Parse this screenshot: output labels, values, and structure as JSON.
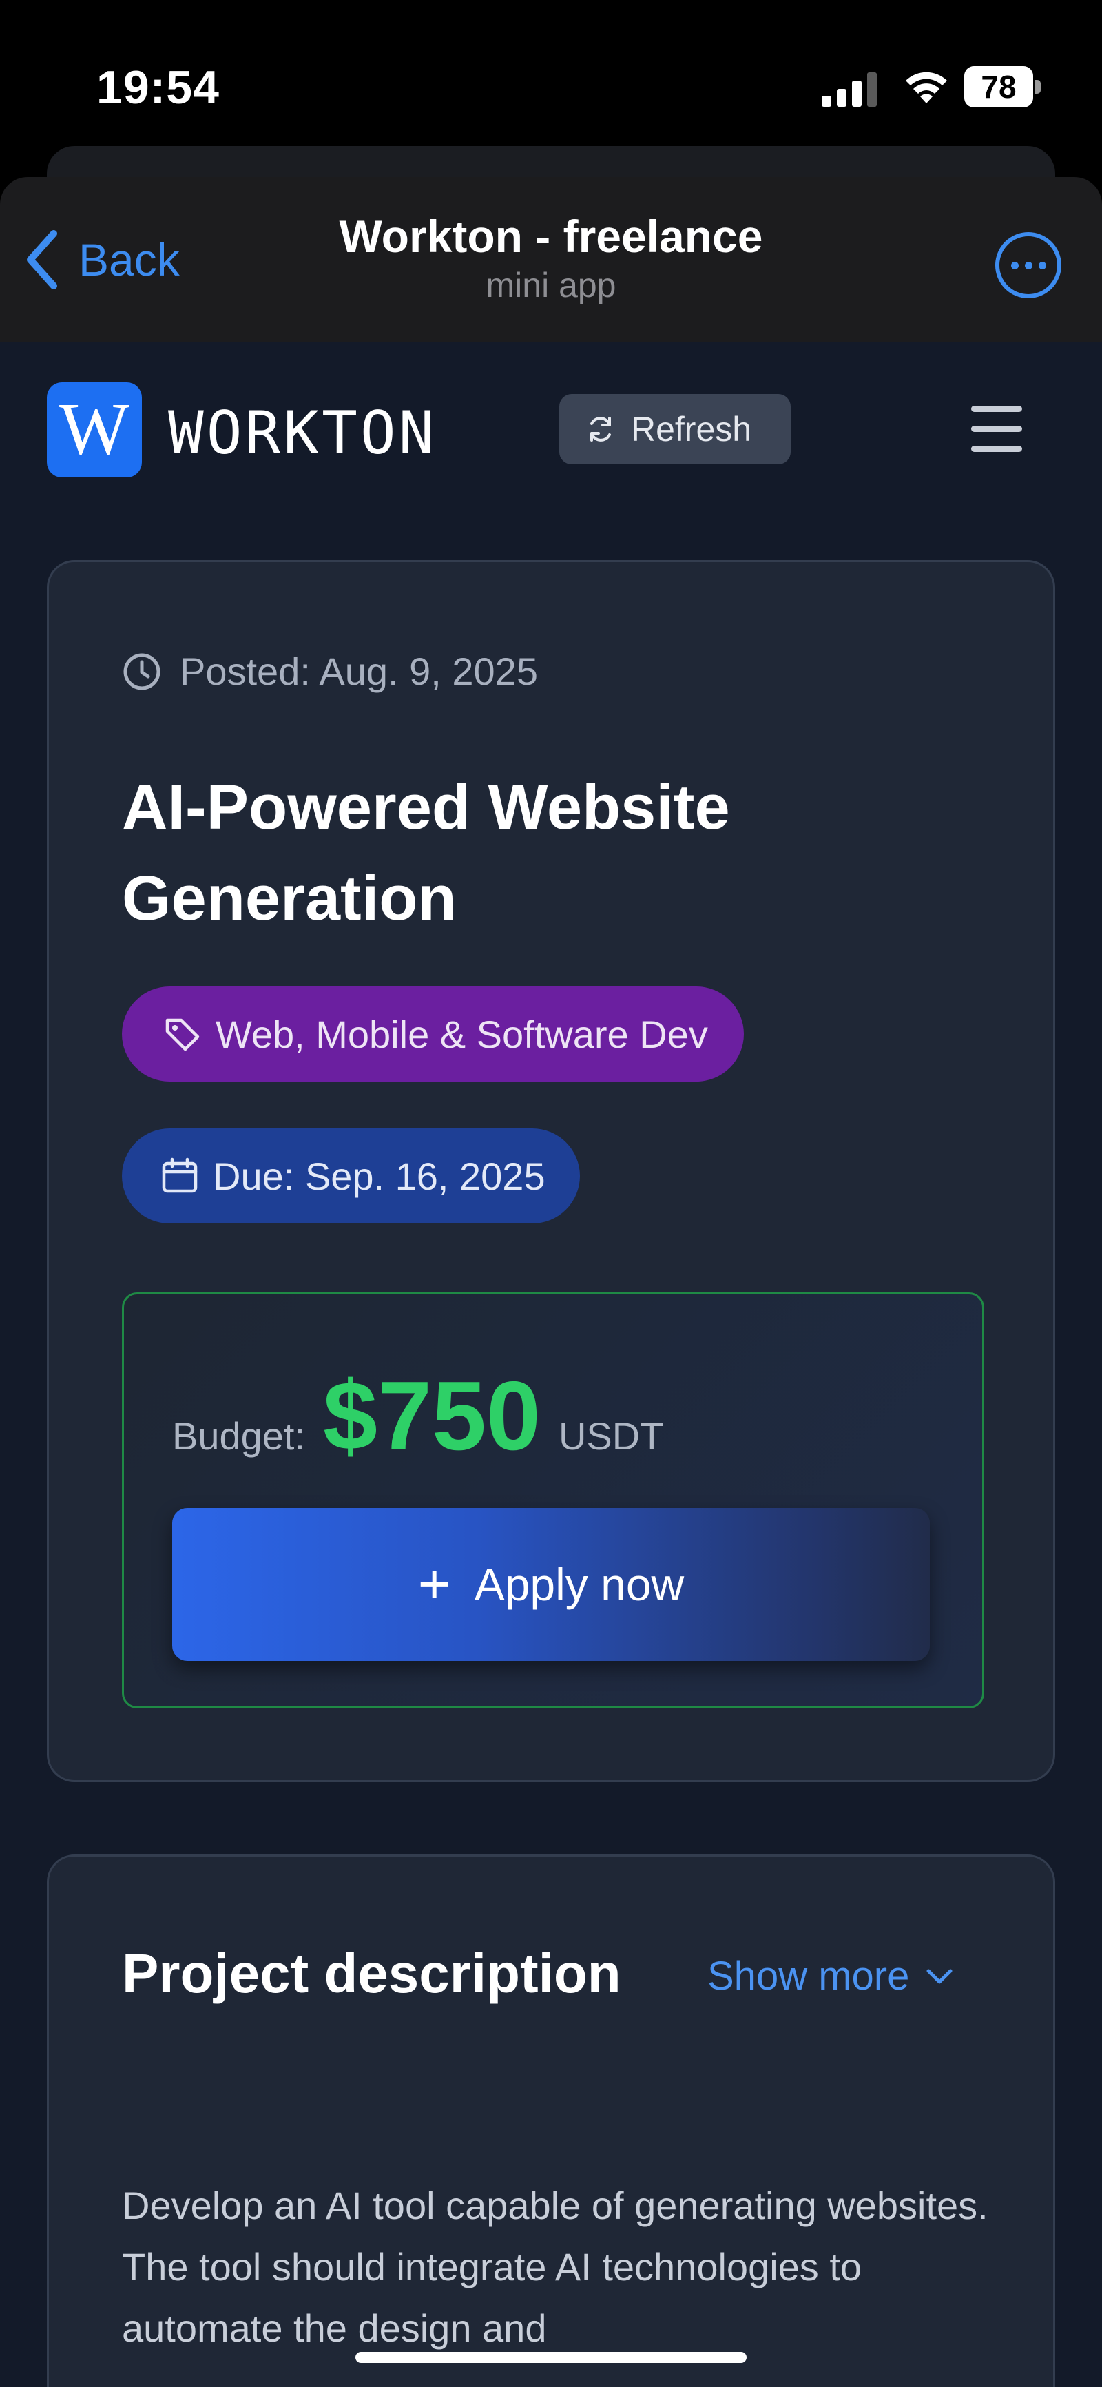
{
  "status_bar": {
    "time": "19:54",
    "battery_level": "78",
    "icons": [
      "signal-icon",
      "wifi-icon",
      "battery-icon"
    ]
  },
  "header": {
    "back_label": "Back",
    "title": "Workton - freelance",
    "subtitle": "mini app",
    "icons": [
      "chevron-left-icon",
      "more-icon"
    ]
  },
  "topbar": {
    "logo_letter": "W",
    "brand": "WORKTON",
    "refresh_label": "Refresh",
    "icons": [
      "refresh-icon",
      "menu-icon"
    ]
  },
  "job": {
    "posted": "Posted: Aug. 9, 2025",
    "title": "AI-Powered Website Generation",
    "category": "Web, Mobile & Software Dev",
    "due": "Due: Sep. 16, 2025",
    "budget_label": "Budget:",
    "budget_amount": "$750",
    "budget_currency": "USDT",
    "apply_plus": "+",
    "apply_label": "Apply now",
    "icons": [
      "clock-icon",
      "tag-icon",
      "calendar-icon",
      "plus-icon"
    ]
  },
  "description": {
    "heading": "Project description",
    "show_more": "Show more",
    "text": "Develop an AI tool capable of generating websites. The tool should integrate AI technologies to automate the design and",
    "icons": [
      "chevron-down-icon"
    ]
  },
  "colors": {
    "accent": "#3d8cf0",
    "budget_green": "#2ed067",
    "category_tag": "#6b1fa0",
    "due_tag": "#1e3f95",
    "card_bg": "#1f2736",
    "page_bg": "#131a29"
  }
}
